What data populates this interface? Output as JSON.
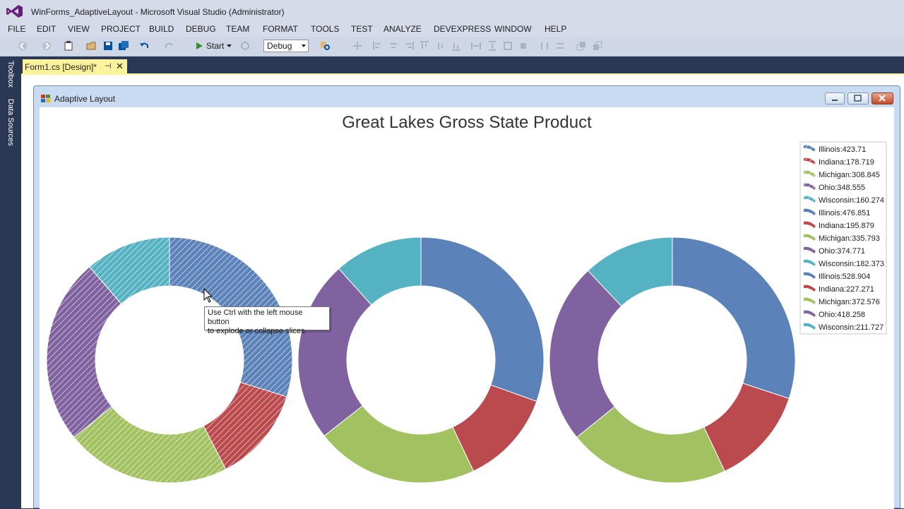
{
  "window": {
    "title": "WinForms_AdaptiveLayout - Microsoft Visual Studio (Administrator)"
  },
  "menu": [
    "FILE",
    "EDIT",
    "VIEW",
    "PROJECT",
    "BUILD",
    "DEBUG",
    "TEAM",
    "FORMAT",
    "TOOLS",
    "TEST",
    "ANALYZE",
    "DEVEXPRESS",
    "WINDOW",
    "HELP"
  ],
  "toolbar": {
    "start_label": "Start",
    "configuration": "Debug"
  },
  "side_tabs": [
    "Toolbox",
    "Data Sources"
  ],
  "doc_tab": {
    "label": "Form1.cs [Design]*",
    "pin": "⊣",
    "close": "✕"
  },
  "form": {
    "title": "Adaptive Layout"
  },
  "tooltip": {
    "line1": "Use Ctrl with the left mouse button",
    "line2": "to explode or collapse slices."
  },
  "colors": {
    "illinois": "#5b83b9",
    "indiana": "#bb4a4e",
    "michigan": "#a2c161",
    "ohio": "#8162a0",
    "wisconsin": "#55b2c3"
  },
  "chart_data": {
    "type": "pie",
    "style": "doughnut",
    "title": "Great Lakes Gross State Product",
    "legend_position": "right",
    "categories": [
      "Illinois",
      "Indiana",
      "Michigan",
      "Ohio",
      "Wisconsin"
    ],
    "series": [
      {
        "values": [
          423.71,
          178.719,
          308.845,
          348.555,
          160.274
        ],
        "pattern": "hatched"
      },
      {
        "values": [
          476.851,
          195.879,
          335.793,
          374.771,
          182.373
        ]
      },
      {
        "values": [
          528.904,
          227.271,
          372.576,
          418.258,
          211.727
        ]
      }
    ],
    "legend": [
      "Illinois:423.71",
      "Indiana:178.719",
      "Michigan:308.845",
      "Ohio:348.555",
      "Wisconsin:160.274",
      "Illinois:476.851",
      "Indiana:195.879",
      "Michigan:335.793",
      "Ohio:374.771",
      "Wisconsin:182.373",
      "Illinois:528.904",
      "Indiana:227.271",
      "Michigan:372.576",
      "Ohio:418.258",
      "Wisconsin:211.727"
    ]
  }
}
